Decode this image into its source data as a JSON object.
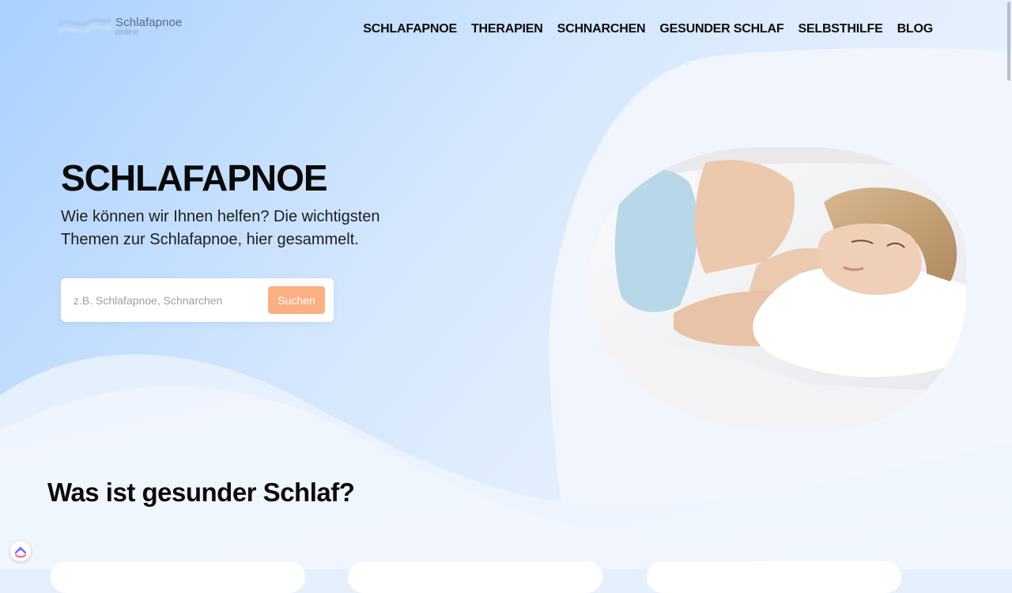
{
  "logo": {
    "brand": "Schlafapnoe",
    "sub": "online"
  },
  "nav": [
    {
      "label": "SCHLAFAPNOE"
    },
    {
      "label": "THERAPIEN"
    },
    {
      "label": "SCHNARCHEN"
    },
    {
      "label": "GESUNDER SCHLAF"
    },
    {
      "label": "SELBSTHILFE"
    },
    {
      "label": "BLOG"
    }
  ],
  "hero": {
    "title": "SCHLAFAPNOE",
    "subtitle": "Wie können wir Ihnen helfen? Die wichtigsten Themen zur Schlafapnoe, hier gesammelt.",
    "image_subject": "woman-sleeping-on-pillow"
  },
  "search": {
    "placeholder": "z.B. Schlafapnoe, Schnarchen",
    "value": "",
    "button_label": "Suchen"
  },
  "section": {
    "title": "Was ist gesunder Schlaf?"
  },
  "colors": {
    "accent_button": "#fcaf83",
    "hero_bg_left": "#a9d1ff",
    "hero_bg_right": "#eef4fd"
  },
  "icons": {
    "feedback_widget": "clickup-icon",
    "logo": "wave-logo-icon"
  }
}
